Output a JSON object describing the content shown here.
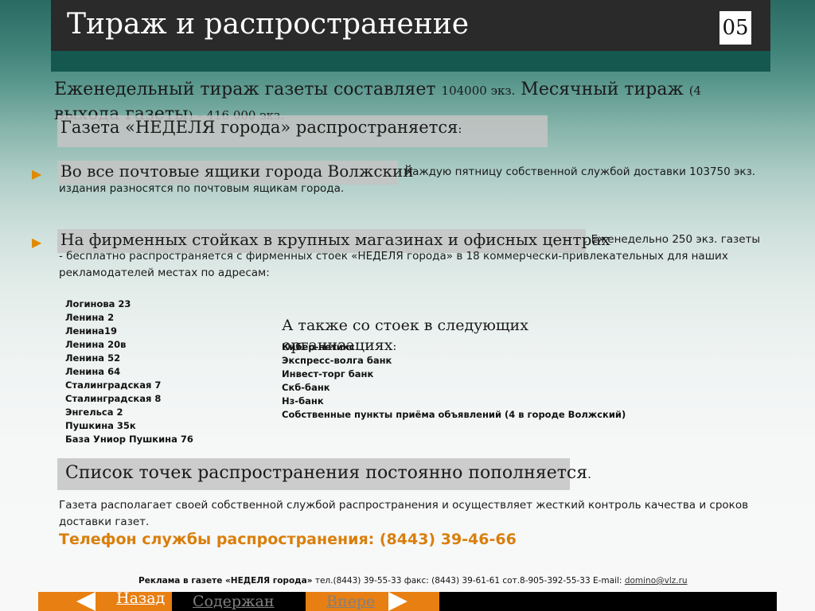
{
  "header": {
    "title": "Тираж и распространение",
    "page_number": "05"
  },
  "lead": {
    "part1": "Еженедельный тираж газеты составляет ",
    "num1": "104000 экз.",
    "part2": " Месячный тираж ",
    "num2": "(4",
    "part3": " выхода газеты",
    "num3": ") – 416 000 экз."
  },
  "distribution": {
    "heading": "Газета «НЕДЕЛЯ города» распространяется",
    "heading_colon": ":",
    "items": [
      {
        "title": "Во все почтовые ящики города Волжский",
        "text": ". Каждую пятницу собственной службой доставки  103750 экз. издания разносятся по почтовым ящикам города."
      },
      {
        "title": "На фирменных стойках в крупных магазинах и офисных центрах",
        "text": ". Еженедельно 250 экз. газеты -  бесплатно распространяется с фирменных стоек «НЕДЕЛЯ города» в 18 коммерчески-привлекательных для наших рекламодателей местах по адресам:"
      }
    ],
    "addresses": [
      "Логинова 23",
      "Ленина 2",
      "Ленина19",
      "Ленина 20в",
      "Ленина 52",
      "Ленина 64",
      "Сталинградская 7",
      "Сталинградская 8",
      "Энгельса 2",
      "Пушкина 35к",
      "База Униор Пушкина 76"
    ],
    "also_heading": "А также со стоек в следующих организациях",
    "also_colon": ":",
    "organizations": [
      "Кибер-нетикс",
      "Экспресс-волга банк",
      "Инвест-торг банк",
      "Скб-банк",
      "Нз-банк",
      "Собственные пункты приёма объявлений (4 в городе Волжский)"
    ]
  },
  "replenish": {
    "text": "Список точек распространения постоянно пополняется",
    "dot": "."
  },
  "description": "Газета располагает своей собственной службой распространения и осуществляет жесткий контроль качества и сроков доставки газет.",
  "phone": "Телефон службы распространения: (8443) 39-46-66",
  "footer": {
    "label": "Реклама в газете «НЕДЕЛЯ города»",
    "contacts": " тел.(8443) 39-55-33  факс: (8443) 39-61-61  сот.8-905-392-55-33  E-mail: ",
    "email": "domino@vlz.ru"
  },
  "nav": {
    "back": "Назад",
    "contents": "Содержан",
    "forward": "Впере"
  },
  "colors": {
    "accent": "#e87f12",
    "phone": "#d97f0c",
    "header_bg": "#2a2a2a",
    "header_stripe": "#14584f"
  }
}
